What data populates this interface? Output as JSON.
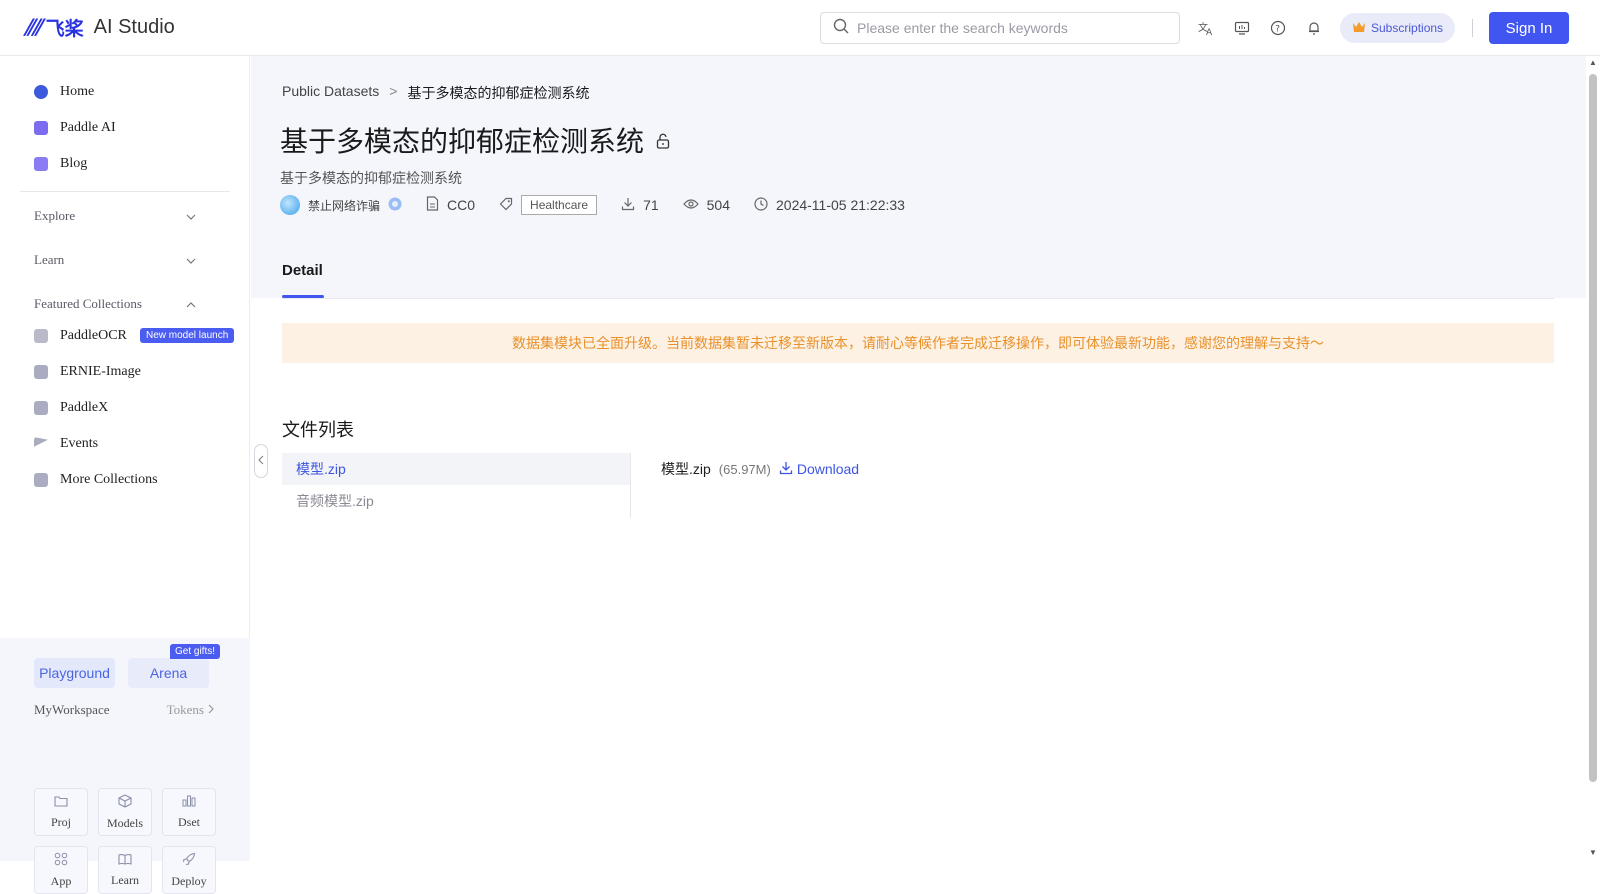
{
  "header": {
    "logo_cn": "飞桨",
    "logo_text": "AI Studio",
    "search_placeholder": "Please enter the search keywords",
    "subscriptions_label": "Subscriptions",
    "signin_label": "Sign In"
  },
  "sidebar": {
    "items": [
      {
        "label": "Home",
        "color": "#3b5bdb"
      },
      {
        "label": "Paddle AI",
        "color": "#7c6cf0"
      },
      {
        "label": "Blog",
        "color": "#8a7cf5"
      }
    ],
    "sections": [
      {
        "label": "Explore",
        "expanded": false
      },
      {
        "label": "Learn",
        "expanded": false
      },
      {
        "label": "Featured Collections",
        "expanded": true
      }
    ],
    "collections": [
      {
        "label": "PaddleOCR",
        "badge": "New model launch"
      },
      {
        "label": "ERNIE-Image"
      },
      {
        "label": "PaddleX"
      },
      {
        "label": "Events"
      },
      {
        "label": "More Collections"
      }
    ],
    "bottom": {
      "playground_label": "Playground",
      "arena_label": "Arena",
      "gift_badge": "Get gifts!",
      "workspace_label": "MyWorkspace",
      "tokens_label": "Tokens",
      "tiles": [
        "Proj",
        "Models",
        "Dset",
        "App",
        "Learn",
        "Deploy"
      ]
    }
  },
  "main": {
    "breadcrumb": {
      "parent": "Public Datasets",
      "separator": ">",
      "current": "基于多模态的抑郁症检测系统"
    },
    "title": "基于多模态的抑郁症检测系统",
    "subtitle": "基于多模态的抑郁症检测系统",
    "meta": {
      "author": "禁止网络诈骗",
      "license": "CC0",
      "tag": "Healthcare",
      "downloads": "71",
      "views": "504",
      "date": "2024-11-05 21:22:33"
    },
    "tab_label": "Detail",
    "notice": "数据集模块已全面升级。当前数据集暂未迁移至新版本，请耐心等候作者完成迁移操作，即可体验最新功能，感谢您的理解与支持～",
    "files_title": "文件列表",
    "files": [
      {
        "name": "模型.zip",
        "active": true
      },
      {
        "name": "音频模型.zip",
        "active": false
      }
    ],
    "selected_file": {
      "name": "模型.zip",
      "size": "(65.97M)",
      "download_label": "Download"
    }
  },
  "colors": {
    "accent": "#4155f0",
    "notice_bg": "#fdf1e4",
    "notice_text": "#e8912b"
  }
}
